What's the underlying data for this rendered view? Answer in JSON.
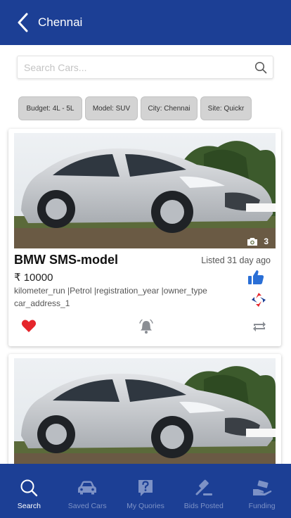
{
  "header": {
    "title": "Chennai",
    "back_icon": "chevron-left-icon"
  },
  "search": {
    "placeholder": "Search Cars...",
    "value": "",
    "icon": "search-icon"
  },
  "filters": [
    {
      "label": "Budget: 4L - 5L"
    },
    {
      "label": "Model: SUV"
    },
    {
      "label": "City: Chennai"
    },
    {
      "label": "Site: Quickr"
    }
  ],
  "listings": [
    {
      "title": "BMW SMS-model",
      "listed": "Listed 31 day ago",
      "price": "₹ 10000",
      "specs": "kilometer_run |Petrol |registration_year |owner_type",
      "address": "car_address_1",
      "photo_count": "3"
    },
    {
      "title": "",
      "listed": "",
      "price": "",
      "specs": "",
      "address": "",
      "photo_count": ""
    }
  ],
  "nav": [
    {
      "label": "Search",
      "icon": "search-icon",
      "active": true
    },
    {
      "label": "Saved Cars",
      "icon": "car-icon",
      "active": false
    },
    {
      "label": "My Quories",
      "icon": "question-icon",
      "active": false
    },
    {
      "label": "Bids Posted",
      "icon": "gavel-icon",
      "active": false
    },
    {
      "label": "Funding",
      "icon": "hand-money-icon",
      "active": false
    }
  ],
  "colors": {
    "primary": "#1c3f95",
    "heart": "#e5252b",
    "thumb": "#2a6fd6",
    "nav_inactive": "#7d92c6"
  }
}
